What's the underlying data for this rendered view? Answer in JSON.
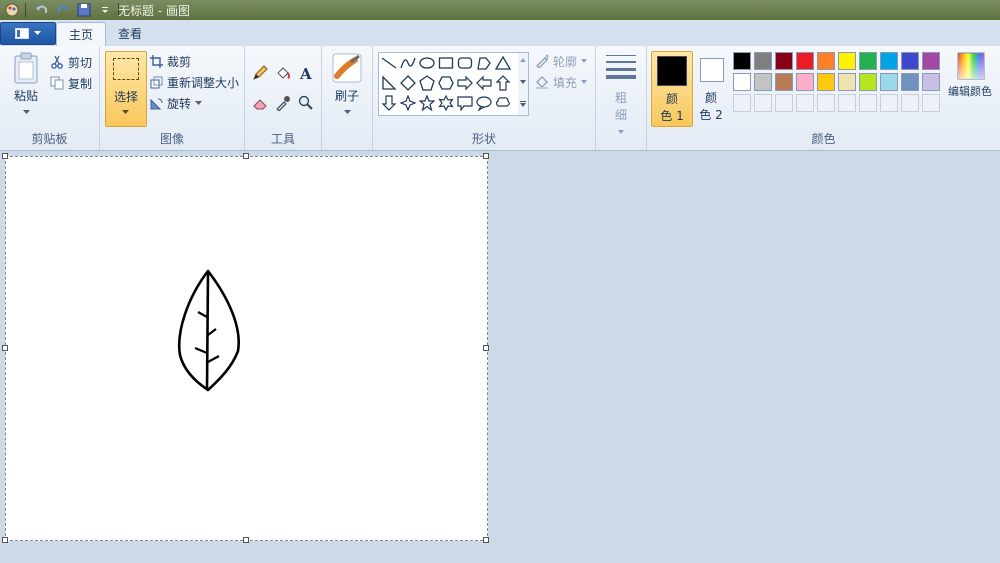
{
  "window": {
    "title": "无标题 - 画图"
  },
  "tabs": {
    "home": "主页",
    "view": "查看"
  },
  "clipboard": {
    "group_label": "剪贴板",
    "paste": "粘贴",
    "cut": "剪切",
    "copy": "复制"
  },
  "image": {
    "group_label": "图像",
    "select": "选择",
    "crop": "裁剪",
    "resize": "重新调整大小",
    "rotate": "旋转"
  },
  "tools": {
    "group_label": "工具"
  },
  "brushes": {
    "label": "刷子"
  },
  "shapes": {
    "group_label": "形状",
    "outline": "轮廓",
    "fill": "填充"
  },
  "size": {
    "label_line1": "粗",
    "label_line2": "细"
  },
  "colors": {
    "group_label": "颜色",
    "color1_line1": "颜",
    "color1_line2": "色 1",
    "color2_line1": "颜",
    "color2_line2": "色 2",
    "edit": "编辑颜色",
    "color1_value": "#000000",
    "color2_value": "#ffffff",
    "palette_row1": [
      "#000000",
      "#7f7f7f",
      "#880015",
      "#ed1c24",
      "#ff7f27",
      "#fff200",
      "#22b14c",
      "#00a2e8",
      "#3f48cc",
      "#a349a4"
    ],
    "palette_row2": [
      "#ffffff",
      "#c3c3c3",
      "#b97a57",
      "#ffaec9",
      "#ffc90e",
      "#efe4b0",
      "#b5e61d",
      "#99d9ea",
      "#7092be",
      "#c8bfe7"
    ]
  }
}
